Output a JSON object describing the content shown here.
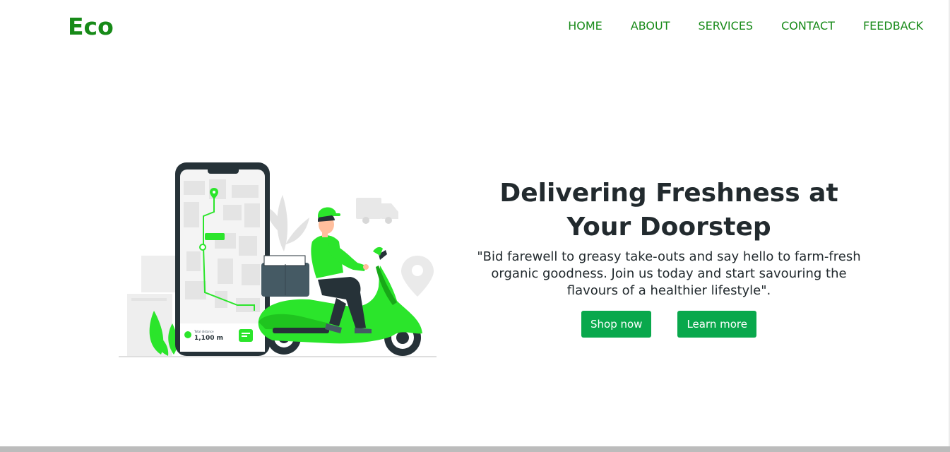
{
  "brand": {
    "logo_text": "Eco",
    "color": "#178a18"
  },
  "nav": {
    "items": [
      {
        "label": "HOME"
      },
      {
        "label": "ABOUT"
      },
      {
        "label": "SERVICES"
      },
      {
        "label": "CONTACT"
      },
      {
        "label": "FEEDBACK"
      }
    ]
  },
  "hero": {
    "title_line1": "Delivering Freshness at",
    "title_line2": "Your Doorstep",
    "subtitle": "\"Bid farewell to greasy take-outs and say hello to farm-fresh organic goodness. Join us today and start savouring the flavours of a healthier lifestyle\".",
    "primary_button": "Shop now",
    "secondary_button": "Learn more",
    "button_color": "#09a84c"
  },
  "illustration": {
    "phone_distance_label": "Total distance",
    "phone_distance_value": "1,100 m",
    "accent_color": "#2be52b"
  }
}
